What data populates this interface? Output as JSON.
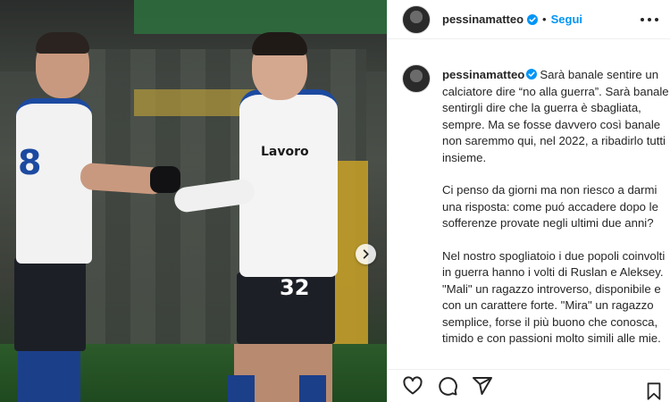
{
  "post": {
    "username": "pessinamatteo",
    "follow_label": "Segui",
    "separator": "•"
  },
  "caption": {
    "username": "pessinamatteo",
    "paragraphs": [
      "Sarà banale sentire un calciatore dire “no alla guerra”. Sarà banale sentirgli dire che la guerra è sbagliata, sempre. Ma se fosse davvero così banale non saremmo qui, nel 2022, a ribadirlo tutti insieme.",
      "Ci penso da giorni ma non riesco a darmi una risposta: come puó accadere dopo le sofferenze provate negli ultimi due anni?",
      "Nel nostro spogliatoio i due popoli coinvolti in guerra hanno i volti di Ruslan e Aleksey. \"Mali\" un ragazzo introverso, disponibile e con un carattere forte. \"Mira\" un ragazzo semplice, forse il più buono che conosca, timido e con passioni molto simili alle mie."
    ]
  },
  "photo": {
    "shirt_number_left": "8",
    "shirt_number_right": "32",
    "sponsor_text": "Lavoro"
  },
  "icons": {
    "verified": "verified-badge-icon",
    "more": "more-options-icon",
    "next": "chevron-right-icon",
    "like": "heart-icon",
    "comment": "comment-icon",
    "share": "share-icon",
    "save": "bookmark-icon"
  },
  "colors": {
    "accent": "#0095f6",
    "text": "#262626",
    "border": "#efefef"
  }
}
